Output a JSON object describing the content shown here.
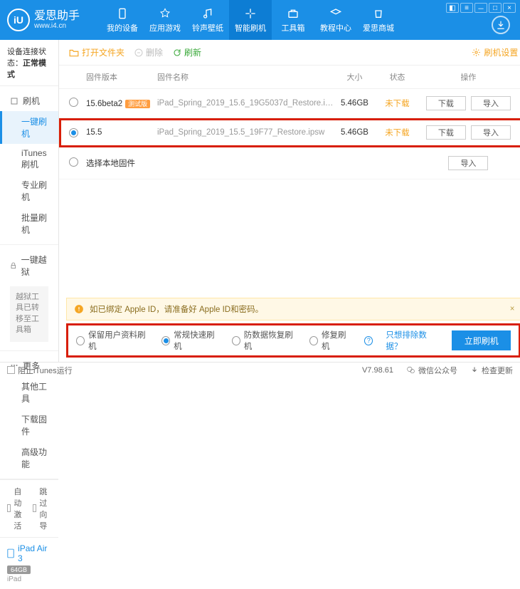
{
  "brand": {
    "title": "爱思助手",
    "url": "www.i4.cn",
    "logo_letter": "iU"
  },
  "nav": [
    {
      "label": "我的设备"
    },
    {
      "label": "应用游戏"
    },
    {
      "label": "铃声壁纸"
    },
    {
      "label": "智能刷机",
      "active": true
    },
    {
      "label": "工具箱"
    },
    {
      "label": "教程中心"
    },
    {
      "label": "爱思商城"
    }
  ],
  "sidebar": {
    "conn_status_label": "设备连接状态：",
    "conn_status_value": "正常模式",
    "sections": {
      "flash": {
        "head": "刷机",
        "items": [
          "一键刷机",
          "iTunes刷机",
          "专业刷机",
          "批量刷机"
        ],
        "active_index": 0
      },
      "jailbreak": {
        "head": "一键越狱",
        "note": "越狱工具已转移至工具箱"
      },
      "more": {
        "head": "更多",
        "items": [
          "其他工具",
          "下载固件",
          "高级功能"
        ]
      }
    },
    "opts": {
      "auto_activate": "自动激活",
      "skip_guide": "跳过向导"
    },
    "device": {
      "name": "iPad Air 3",
      "storage": "64GB",
      "model": "iPad"
    }
  },
  "toolbar": {
    "open_folder": "打开文件夹",
    "delete": "删除",
    "refresh": "刷新",
    "settings": "刷机设置"
  },
  "table": {
    "headers": {
      "version": "固件版本",
      "name": "固件名称",
      "size": "大小",
      "status": "状态",
      "ops": "操作"
    },
    "rows": [
      {
        "selected": false,
        "version": "15.6beta2",
        "beta": "测试版",
        "name": "iPad_Spring_2019_15.6_19G5037d_Restore.i…",
        "size": "5.46GB",
        "status": "未下载"
      },
      {
        "selected": true,
        "version": "15.5",
        "beta": "",
        "name": "iPad_Spring_2019_15.5_19F77_Restore.ipsw",
        "size": "5.46GB",
        "status": "未下载"
      }
    ],
    "select_local": "选择本地固件",
    "btn_download": "下载",
    "btn_import": "导入"
  },
  "warning": "如已绑定 Apple ID，请准备好 Apple ID和密码。",
  "modes": {
    "opts": [
      "保留用户资料刷机",
      "常规快速刷机",
      "防数据恢复刷机",
      "修复刷机"
    ],
    "selected_index": 1,
    "exclude_link": "只想排除数据？",
    "flash_btn": "立即刷机"
  },
  "statusbar": {
    "block_itunes": "阻止iTunes运行",
    "version": "V7.98.61",
    "wechat": "微信公众号",
    "check_update": "检查更新"
  }
}
